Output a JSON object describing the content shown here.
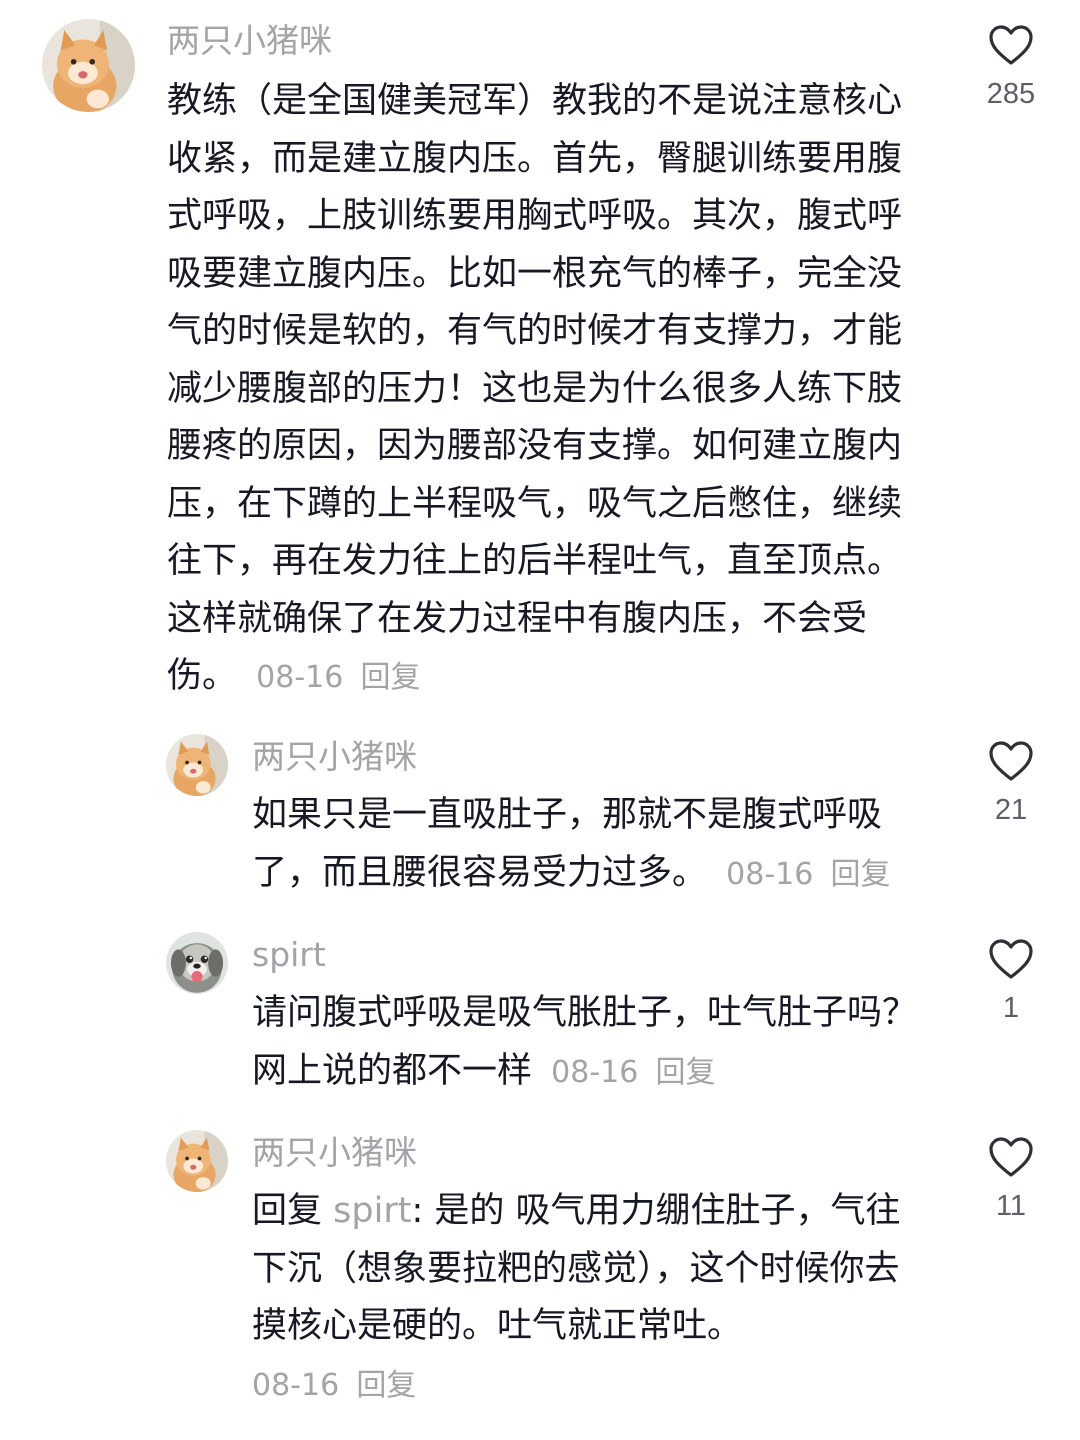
{
  "comments": [
    {
      "username": "两只小猪咪",
      "text": "教练（是全国健美冠军）教我的不是说注意核心收紧，而是建立腹内压。首先，臀腿训练要用腹式呼吸，上肢训练要用胸式呼吸。其次，腹式呼吸要建立腹内压。比如一根充气的棒子，完全没气的时候是软的，有气的时候才有支撑力，才能减少腰腹部的压力！这也是为什么很多人练下肢腰疼的原因，因为腰部没有支撑。如何建立腹内压，在下蹲的上半程吸气，吸气之后憋住，继续往下，再在发力往上的后半程吐气，直至顶点。这样就确保了在发力过程中有腹内压，不会受伤。",
      "date": "08-16",
      "reply_label": "回复",
      "likes": "285",
      "avatar_icon": "cat-avatar"
    },
    {
      "username": "两只小猪咪",
      "text": "如果只是一直吸肚子，那就不是腹式呼吸了，而且腰很容易受力过多。",
      "date": "08-16",
      "reply_label": "回复",
      "likes": "21",
      "avatar_icon": "cat-avatar"
    },
    {
      "username": "spirt",
      "text": "请问腹式呼吸是吸气胀肚子，吐气肚子吗？网上说的都不一样",
      "date": "08-16",
      "reply_label": "回复",
      "likes": "1",
      "avatar_icon": "dog-avatar"
    },
    {
      "username": "两只小猪咪",
      "reply_prefix": "回复",
      "reply_to": "spirt",
      "text": ": 是的 吸气用力绷住肚子，气往下沉（想象要拉粑的感觉），这个时候你去摸核心是硬的。吐气就正常吐。",
      "date": "08-16",
      "reply_label": "回复",
      "likes": "11",
      "avatar_icon": "cat-avatar"
    }
  ],
  "colors": {
    "text": "#161823",
    "meta": "#a3a3a8",
    "like_count": "#5e5e66"
  }
}
